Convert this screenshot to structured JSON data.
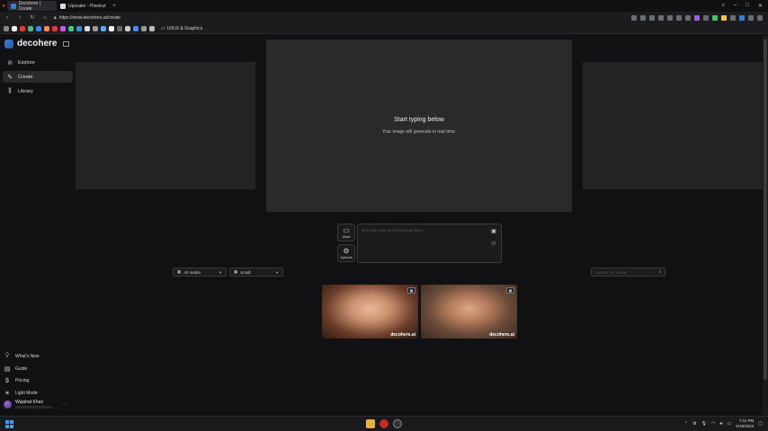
{
  "browser": {
    "tabs": [
      {
        "title": "Decohere | Create",
        "active": true
      },
      {
        "title": "Upscaler - Pixelcut",
        "active": false
      }
    ],
    "url": "https://www.decohere.ai/create",
    "bookmark_folder": "UI/UX & Graphics"
  },
  "sidebar": {
    "brand": "decohere",
    "nav": [
      {
        "label": "Explore",
        "icon": "compass-icon",
        "active": false
      },
      {
        "label": "Create",
        "icon": "pencil-icon",
        "active": true
      },
      {
        "label": "Library",
        "icon": "library-icon",
        "active": false
      }
    ],
    "footer": [
      {
        "label": "What's New",
        "icon": "lightbulb-icon"
      },
      {
        "label": "Guide",
        "icon": "book-icon"
      },
      {
        "label": "Pricing",
        "icon": "dollar-icon"
      },
      {
        "label": "Light Mode",
        "icon": "sun-icon"
      }
    ],
    "user": {
      "name": "Wajahat Khan"
    }
  },
  "canvas": {
    "title": "Start typing below",
    "subtitle": "Your image will generate in real-time."
  },
  "controls": {
    "aspect_label": "Wide",
    "options_label": "Options",
    "prompt_placeholder": "Describe your desired image here..."
  },
  "filters": {
    "media": "All media",
    "size": "Small",
    "search_placeholder": "Search for media"
  },
  "gallery": [
    {
      "watermark": "decohere.ai"
    },
    {
      "watermark": "decohere.ai"
    }
  ],
  "taskbar": {
    "time": "7:11 PM",
    "date": "5/18/2024"
  },
  "colors": {
    "accent": "#3a7bd5",
    "background": "#111113",
    "panel": "#2a2a2b"
  }
}
